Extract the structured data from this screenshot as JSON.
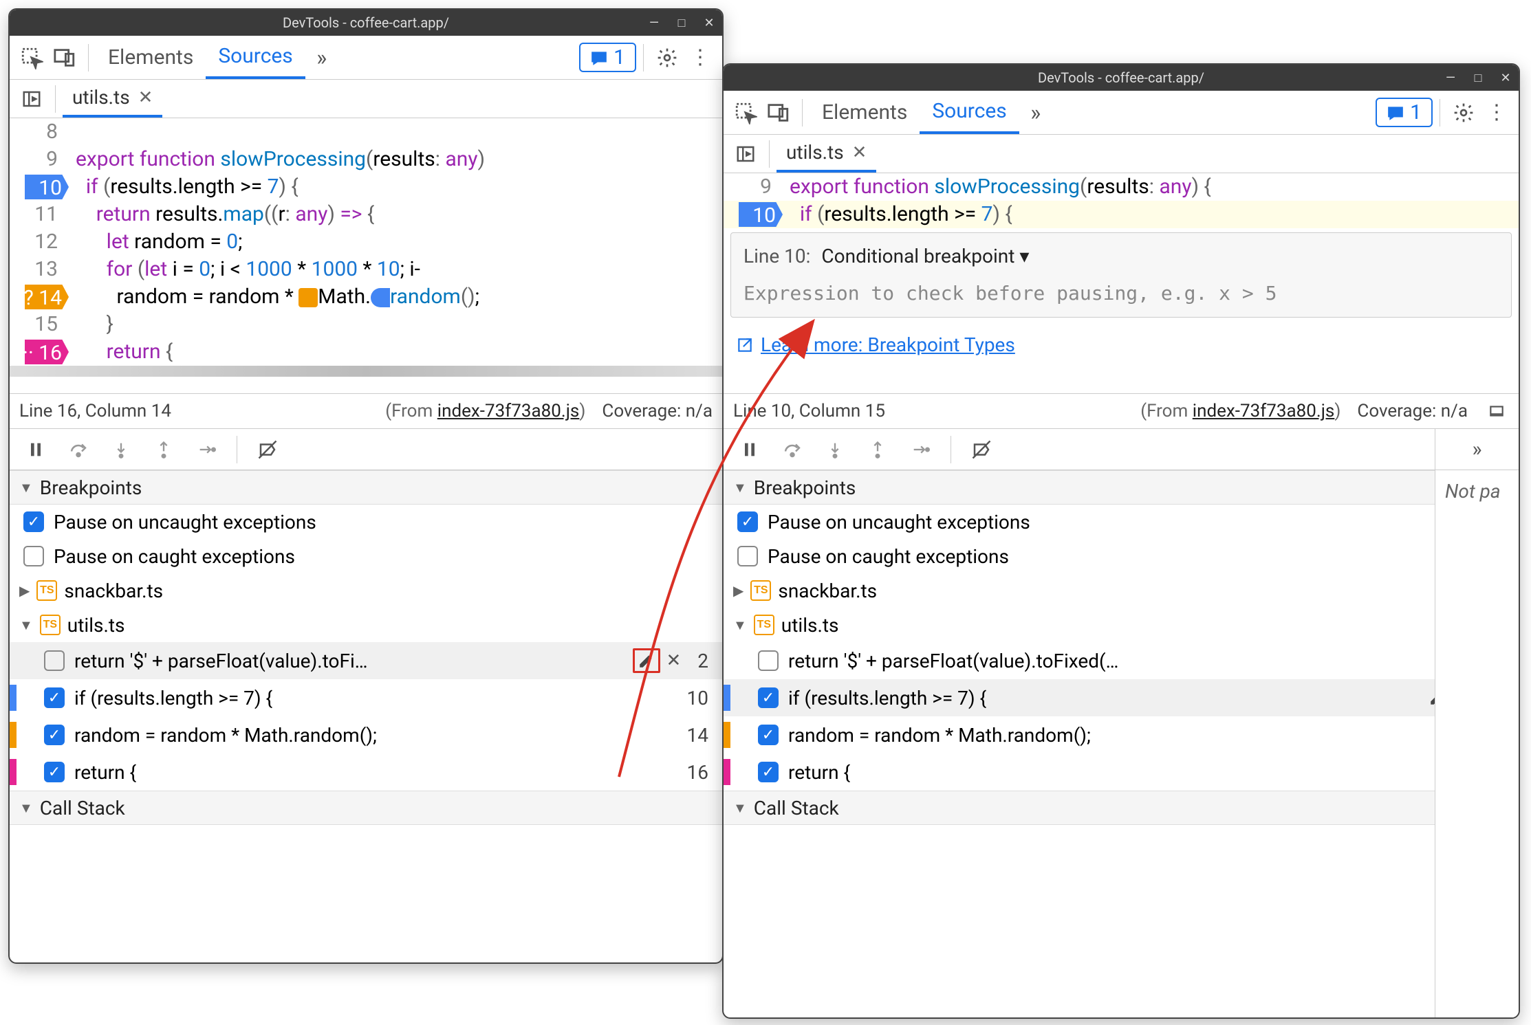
{
  "shared": {
    "window_title": "DevTools - coffee-cart.app/",
    "tabs": {
      "elements": "Elements",
      "sources": "Sources"
    },
    "message_count": "1",
    "file_tab": "utils.ts",
    "from_label": "(From ",
    "from_file": "index-73f73a80.js",
    "from_close": ")",
    "coverage_label": "Coverage: n/a",
    "sections": {
      "breakpoints": "Breakpoints",
      "callstack": "Call Stack"
    },
    "pause_uncaught": "Pause on uncaught exceptions",
    "pause_caught": "Pause on caught exceptions",
    "files": {
      "snackbar": "snackbar.ts",
      "utils": "utils.ts"
    },
    "bp_items": [
      {
        "code": "return '$' + parseFloat(value).toFi…",
        "line": "2"
      },
      {
        "code": "if (results.length >= 7) {",
        "line": "10"
      },
      {
        "code": "random = random * Math.random();",
        "line": "14"
      },
      {
        "code": "return {",
        "line": "16"
      }
    ],
    "bp_items_right": [
      {
        "code": "return '$' + parseFloat(value).toFixed(…",
        "line": "2"
      },
      {
        "code": "if (results.length >= 7) {",
        "line": "10"
      },
      {
        "code": "random = random * Math.random();",
        "line": "14"
      },
      {
        "code": "return {",
        "line": "16"
      }
    ]
  },
  "left": {
    "code_lines": [
      {
        "n": "8",
        "html": ""
      },
      {
        "n": "9",
        "html": "export function slowProcessing(results: any)"
      },
      {
        "n": "10",
        "html": "  if (results.length >= 7) {",
        "bp": "blue"
      },
      {
        "n": "11",
        "html": "    return results.map((r: any) => {"
      },
      {
        "n": "12",
        "html": "      let random = 0;"
      },
      {
        "n": "13",
        "html": "      for (let i = 0; i < 1000 * 1000 * 10; i-"
      },
      {
        "n": "14",
        "html": "        random = random * Math.random();",
        "bp": "orange",
        "prefix": "?"
      },
      {
        "n": "15",
        "html": "      }"
      },
      {
        "n": "16",
        "html": "      return {",
        "bp": "pink",
        "prefix": "··"
      }
    ],
    "status_pos": "Line 16, Column 14"
  },
  "right": {
    "code_lines": [
      {
        "n": "9",
        "html": "export function slowProcessing(results: any) {"
      },
      {
        "n": "10",
        "html": "  if (results.length >= 7) {",
        "bp": "blue",
        "hl": true
      }
    ],
    "popup": {
      "line_label": "Line 10:",
      "type_label": "Conditional breakpoint",
      "placeholder": "Expression to check before pausing, e.g. x > 5",
      "learn": "Learn more: Breakpoint Types"
    },
    "status_pos": "Line 10, Column 15",
    "not_paused": "Not pa"
  }
}
